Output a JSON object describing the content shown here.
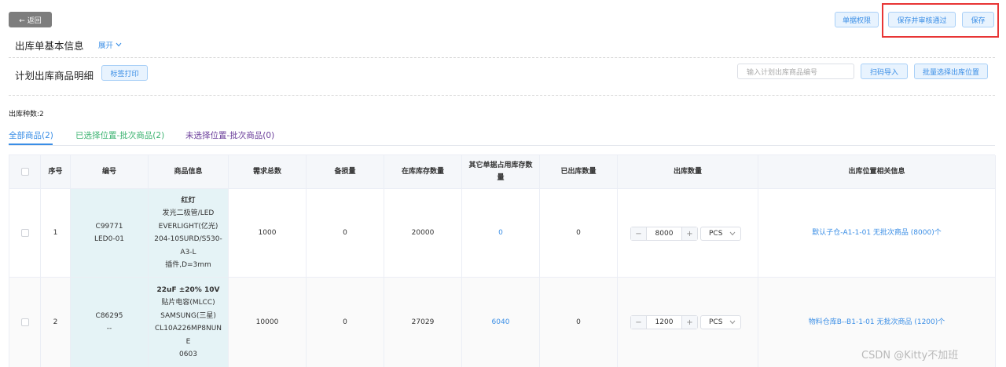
{
  "toolbar": {
    "back_label": "← 返回",
    "permission_label": "单据权限",
    "save_approve_label": "保存并审核通过",
    "save_label": "保存"
  },
  "basic_info": {
    "title": "出库单基本信息",
    "expand_label": "展开"
  },
  "plan": {
    "title": "计划出库商品明细",
    "print_label": "标签打印",
    "search_placeholder": "输入计划出库商品编号",
    "scan_import_label": "扫码导入",
    "batch_select_label": "批量选择出库位置"
  },
  "summary": {
    "kinds_text": "出库种数:2"
  },
  "tabs": [
    {
      "label": "全部商品(2)",
      "color": "#3a8ee6"
    },
    {
      "label": "已选择位置-批次商品(2)",
      "color": "#3cb371"
    },
    {
      "label": "未选择位置-批次商品(0)",
      "color": "#6a3d9a"
    }
  ],
  "table": {
    "headers": {
      "index": "序号",
      "code": "编号",
      "product": "商品信息",
      "demand_total": "需求总数",
      "damaged": "备损量",
      "in_stock": "在库库存数量",
      "other_occupied_1": "其它单据占用库存数",
      "other_occupied_2": "量",
      "shipped": "已出库数量",
      "out_qty": "出库数量",
      "location": "出库位置相关信息"
    },
    "rows": [
      {
        "index": "1",
        "code_1": "C99771",
        "code_2": "LED0-01",
        "product_lines": [
          "红灯",
          "发光二极管/LED",
          "EVERLIGHT(亿光)",
          "204-10SURD/S530-",
          "A3-L",
          "插件,D=3mm"
        ],
        "demand_total": "1000",
        "damaged": "0",
        "in_stock": "20000",
        "other_occupied": "0",
        "shipped": "0",
        "out_qty": "8000",
        "unit": "PCS",
        "location": "默认子仓-A1-1-01 无批次商品 (8000)个"
      },
      {
        "index": "2",
        "code_1": "C86295",
        "code_2": "--",
        "product_lines": [
          "22uF ±20% 10V",
          "贴片电容(MLCC)",
          "SAMSUNG(三星)",
          "CL10A226MP8NUN",
          "E",
          "0603"
        ],
        "demand_total": "10000",
        "damaged": "0",
        "in_stock": "27029",
        "other_occupied": "6040",
        "shipped": "0",
        "out_qty": "1200",
        "unit": "PCS",
        "location": "物料仓库B--B1-1-01 无批次商品 (1200)个"
      }
    ]
  },
  "stepper": {
    "minus": "−",
    "plus": "+"
  },
  "watermark": "CSDN @Kitty不加班"
}
